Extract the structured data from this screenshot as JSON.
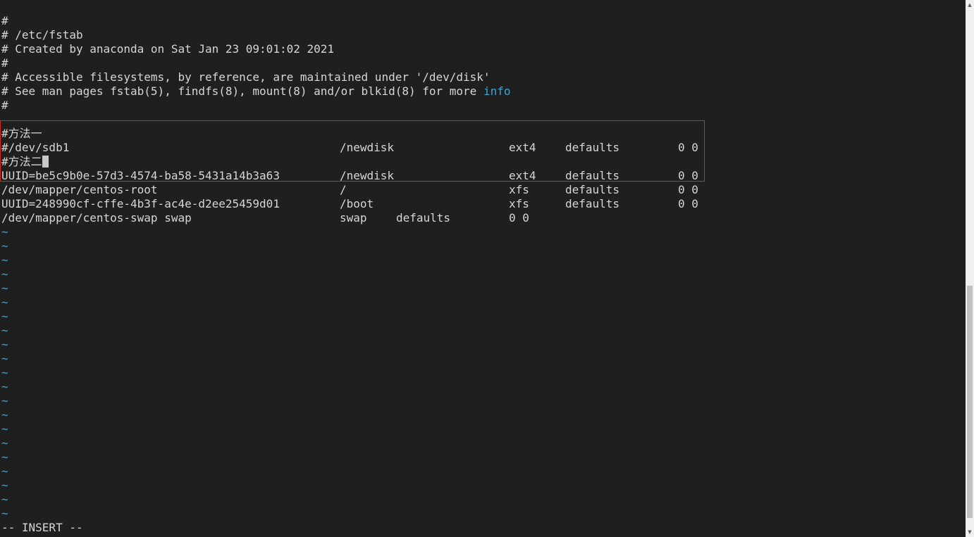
{
  "editor": {
    "comment_lines": [
      "#",
      "# /etc/fstab",
      "# Created by anaconda on Sat Jan 23 09:01:02 2021",
      "#",
      "# Accessible filesystems, by reference, are maintained under '/dev/disk'"
    ],
    "see_man_prefix": "# See man pages fstab(5), findfs(8), mount(8) and/or blkid(8) for more ",
    "see_man_keyword": "info",
    "comment_end": "#",
    "method_one_heading": "#方法一",
    "method_one_entry": {
      "device": "#/dev/sdb1",
      "mount": "/newdisk",
      "fstype": "ext4",
      "options": "defaults",
      "dump_pass": "0 0"
    },
    "method_two_heading": "#方法二",
    "method_two_entry": {
      "device": "UUID=be5c9b0e-57d3-4574-ba58-5431a14b3a63",
      "mount": "/newdisk",
      "fstype": "ext4",
      "options": "defaults",
      "dump_pass": "0 0"
    },
    "root_entry": {
      "device": "/dev/mapper/centos-root",
      "mount": "/",
      "fstype": "xfs",
      "options": "defaults",
      "dump_pass": "0 0"
    },
    "boot_entry": {
      "device": "UUID=248990cf-cffe-4b3f-ac4e-d2ee25459d01",
      "mount": "/boot",
      "fstype": "xfs",
      "options": "defaults",
      "dump_pass": "0 0"
    },
    "swap_entry": {
      "device": "/dev/mapper/centos-swap swap",
      "fstype": "swap",
      "options": "defaults",
      "dump_pass": "0 0"
    },
    "empty_line_marker": "~"
  },
  "status": {
    "mode": "-- INSERT --"
  },
  "colors": {
    "background": "#1f1f1f",
    "text": "#d6d6d6",
    "highlight_keyword": "#39a6d6",
    "annotation_box": "#d02b2b"
  }
}
